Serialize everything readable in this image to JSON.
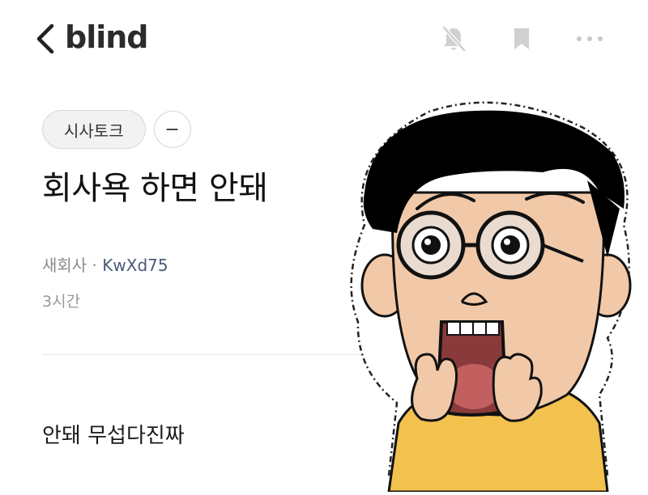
{
  "header": {
    "brand": "blind",
    "icons": [
      "chevron-left-icon",
      "bell-off-icon",
      "bookmark-icon",
      "more-icon"
    ]
  },
  "post": {
    "category": "시사토크",
    "category_more": "−",
    "title": "회사욕 하면 안돼",
    "author_company": "새회사",
    "author_separator": " · ",
    "author_nickname": "KwXd75",
    "time": "3시간",
    "body": "안돼 무섭다진짜"
  },
  "colors": {
    "brand": "#2b2b2b",
    "icon_gray": "#d0d0d0",
    "meta_gray": "#8c8c8c",
    "nickname": "#4a5a78",
    "sweater": "#f2c14e",
    "skin": "#f1c9a8",
    "hair": "#000000"
  }
}
